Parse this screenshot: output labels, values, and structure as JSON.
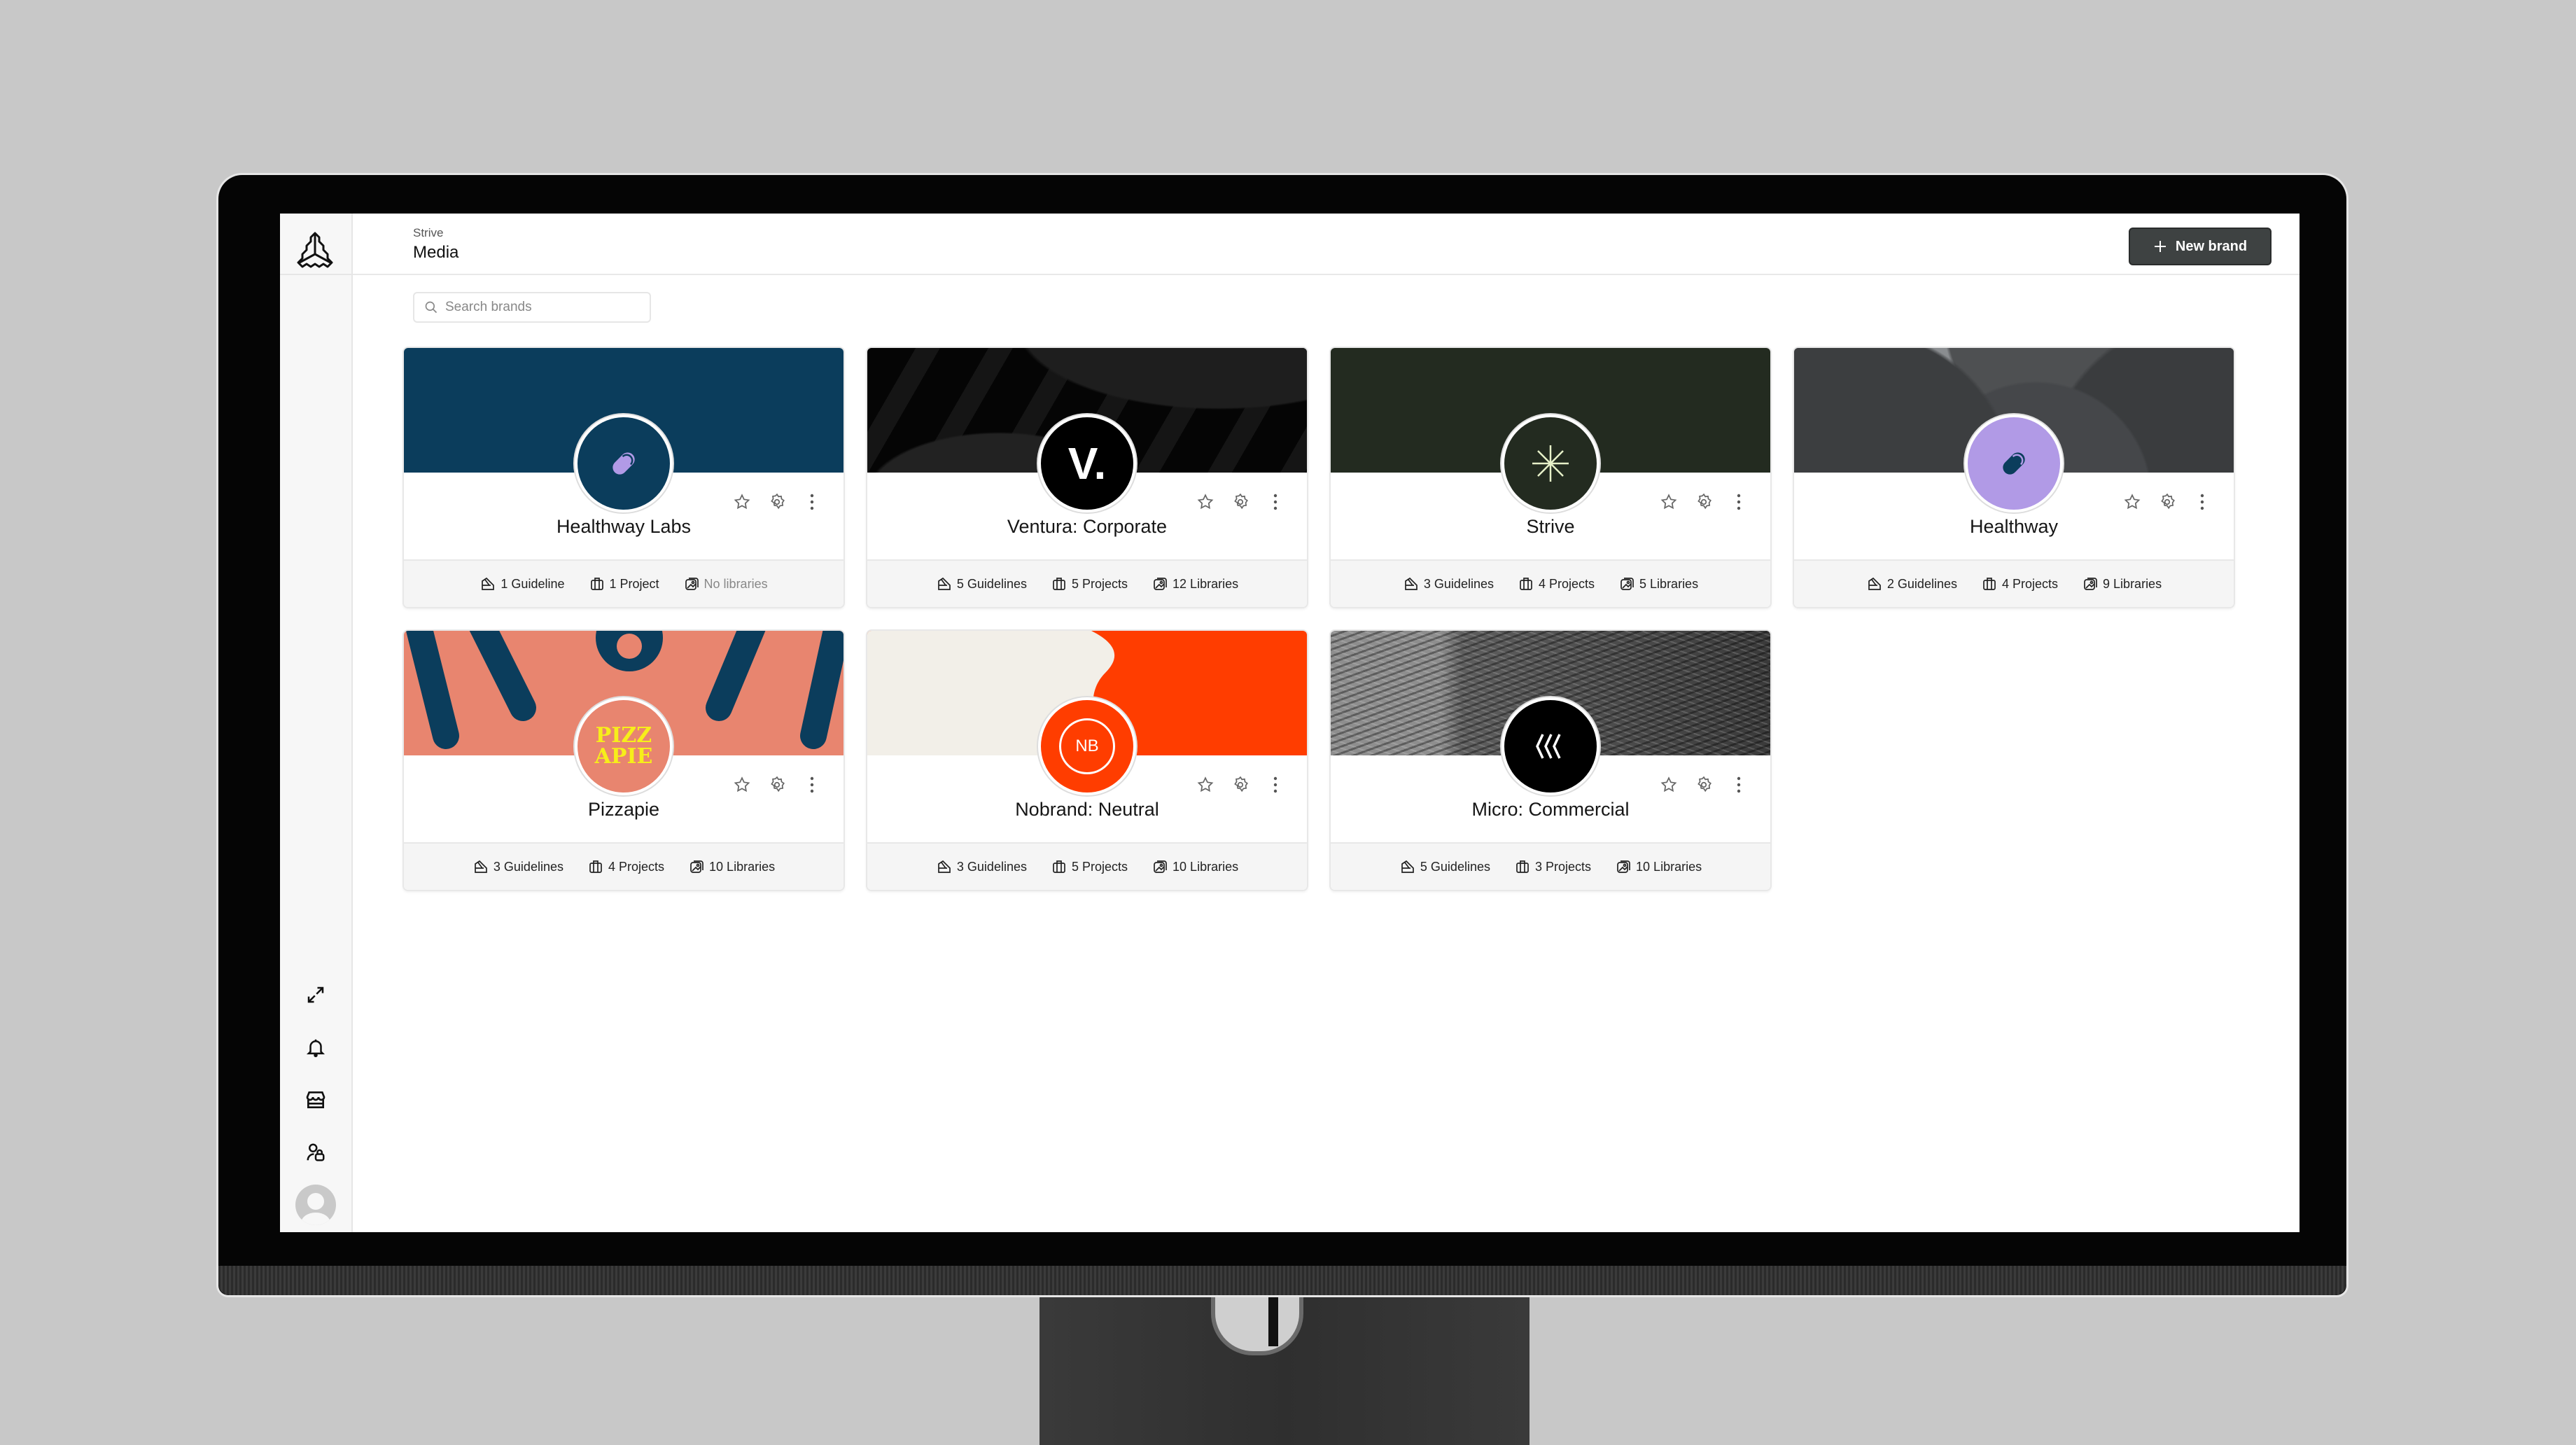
{
  "app": {
    "breadcrumb": "Strive",
    "page_title": "Media",
    "new_brand_label": "New brand",
    "search_placeholder": "Search brands"
  },
  "sidebar": {
    "logo": "triad-logo-icon",
    "items": [
      {
        "name": "expand-icon"
      },
      {
        "name": "bell-icon"
      },
      {
        "name": "storefront-icon"
      },
      {
        "name": "user-lock-icon"
      },
      {
        "name": "avatar"
      }
    ]
  },
  "brands": [
    {
      "name": "Healthway Labs",
      "logo": "pill-icon",
      "cover": "navy",
      "cover_color": "#0b3d5c",
      "badge_color": "#0b3d5c",
      "guidelines": "1 Guideline",
      "projects": "1 Project",
      "libraries": "No libraries",
      "libraries_muted": true
    },
    {
      "name": "Ventura: Corporate",
      "logo": "V.",
      "cover": "black-waves",
      "cover_color": "#0a0a0a",
      "badge_color": "#000000",
      "guidelines": "5 Guidelines",
      "projects": "5 Projects",
      "libraries": "12 Libraries"
    },
    {
      "name": "Strive",
      "logo": "asterisk-icon",
      "cover": "dark-green",
      "cover_color": "#232b20",
      "badge_color": "#232b20",
      "guidelines": "3 Guidelines",
      "projects": "4 Projects",
      "libraries": "5 Libraries"
    },
    {
      "name": "Healthway",
      "logo": "pill-icon",
      "cover": "gray-spheres",
      "cover_color": "#5a5c5e",
      "badge_color": "#b19ae6",
      "guidelines": "2 Guidelines",
      "projects": "4 Projects",
      "libraries": "9 Libraries"
    },
    {
      "name": "Pizzapie",
      "logo": "PIZZ APIE",
      "cover": "salmon-pattern",
      "cover_color": "#e8856f",
      "badge_color": "#e8856f",
      "guidelines": "3 Guidelines",
      "projects": "4 Projects",
      "libraries": "10 Libraries"
    },
    {
      "name": "Nobrand: Neutral",
      "logo": "NB",
      "cover": "cream-orange",
      "cover_color": "#ff3d00",
      "badge_color": "#ff3d00",
      "guidelines": "3 Guidelines",
      "projects": "5 Projects",
      "libraries": "10 Libraries"
    },
    {
      "name": "Micro: Commercial",
      "logo": "chevrons-icon",
      "cover": "mesh-gray",
      "cover_color": "#4a4a4a",
      "badge_color": "#000000",
      "guidelines": "5 Guidelines",
      "projects": "3 Projects",
      "libraries": "10 Libraries"
    }
  ]
}
